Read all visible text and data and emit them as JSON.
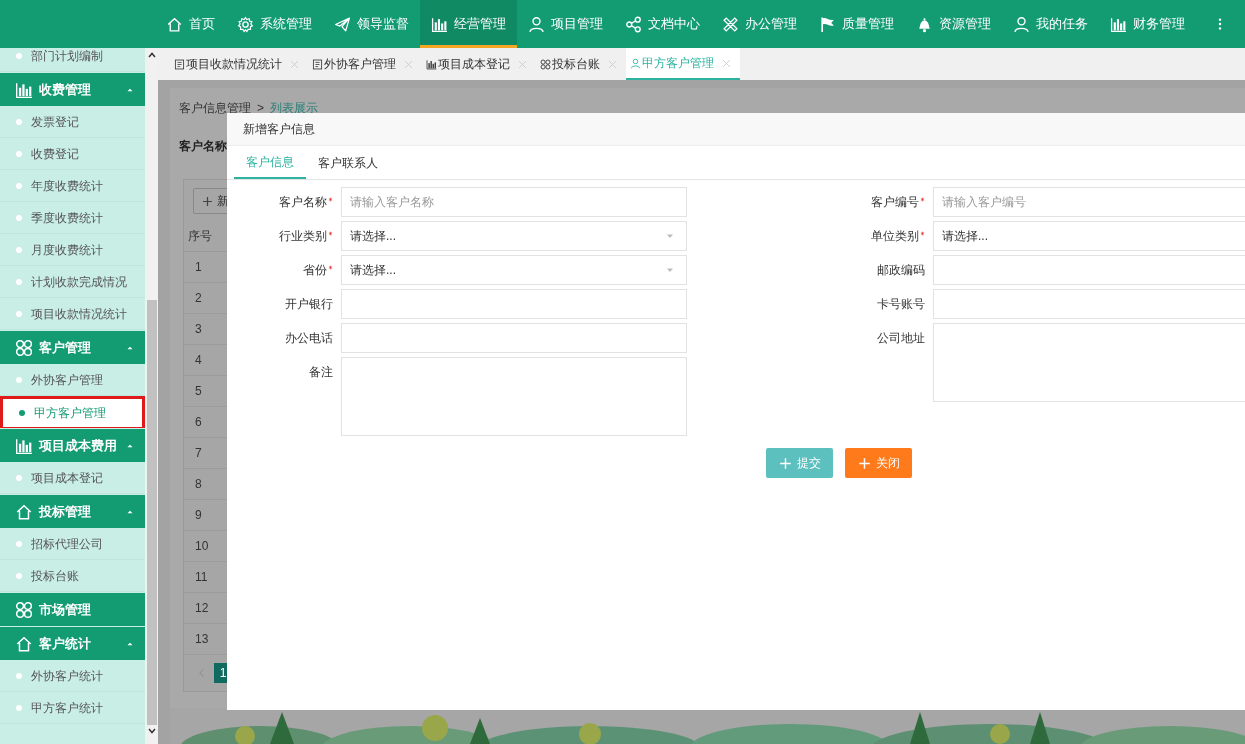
{
  "top_nav": {
    "items": [
      {
        "label": "首页",
        "selected": false
      },
      {
        "label": "系统管理",
        "selected": false
      },
      {
        "label": "领导监督",
        "selected": false
      },
      {
        "label": "经营管理",
        "selected": true
      },
      {
        "label": "项目管理",
        "selected": false
      },
      {
        "label": "文档中心",
        "selected": false
      },
      {
        "label": "办公管理",
        "selected": false
      },
      {
        "label": "质量管理",
        "selected": false
      },
      {
        "label": "资源管理",
        "selected": false
      },
      {
        "label": "我的任务",
        "selected": false
      },
      {
        "label": "财务管理",
        "selected": false
      }
    ]
  },
  "sidebar": {
    "items": [
      {
        "kind": "item",
        "label": "部门计划编制",
        "selected": false
      },
      {
        "kind": "group",
        "label": "收费管理",
        "expanded": true,
        "children": [
          {
            "label": "发票登记",
            "selected": false
          },
          {
            "label": "收费登记",
            "selected": false
          },
          {
            "label": "年度收费统计",
            "selected": false
          },
          {
            "label": "季度收费统计",
            "selected": false
          },
          {
            "label": "月度收费统计",
            "selected": false
          },
          {
            "label": "计划收款完成情况",
            "selected": false
          },
          {
            "label": "项目收款情况统计",
            "selected": false
          }
        ]
      },
      {
        "kind": "group",
        "label": "客户管理",
        "expanded": true,
        "children": [
          {
            "label": "外协客户管理",
            "selected": false
          },
          {
            "label": "甲方客户管理",
            "selected": true
          }
        ]
      },
      {
        "kind": "group",
        "label": "项目成本费用",
        "expanded": true,
        "children": [
          {
            "label": "项目成本登记",
            "selected": false
          }
        ]
      },
      {
        "kind": "group",
        "label": "投标管理",
        "expanded": true,
        "children": [
          {
            "label": "招标代理公司",
            "selected": false
          },
          {
            "label": "投标台账",
            "selected": false
          }
        ]
      },
      {
        "kind": "group",
        "label": "市场管理",
        "expanded": false
      },
      {
        "kind": "group",
        "label": "客户统计",
        "expanded": true,
        "children": [
          {
            "label": "外协客户统计",
            "selected": false
          },
          {
            "label": "甲方客户统计",
            "selected": false
          }
        ]
      }
    ]
  },
  "tabs": [
    {
      "label": "项目收款情况统计",
      "selected": false
    },
    {
      "label": "外协客户管理",
      "selected": false
    },
    {
      "label": "项目成本登记",
      "selected": false
    },
    {
      "label": "投标台账",
      "selected": false
    },
    {
      "label": "甲方客户管理",
      "selected": true
    }
  ],
  "background_page": {
    "breadcrumb": [
      "客户信息管理",
      "列表展示"
    ],
    "breadcrumb_separator": ">",
    "filter_label": "客户名称",
    "add_button": "新",
    "table": {
      "columns": [
        "序号"
      ],
      "rows": [
        "1",
        "2",
        "3",
        "4",
        "5",
        "6",
        "7",
        "8",
        "9",
        "10",
        "11",
        "12",
        "13"
      ]
    },
    "pagination": [
      {
        "label": "1",
        "selected": true
      }
    ]
  },
  "dialog": {
    "title": "新增客户信息",
    "tabs": [
      {
        "label": "客户信息",
        "selected": true
      },
      {
        "label": "客户联系人",
        "selected": false
      }
    ],
    "left_fields": [
      {
        "label": "客户名称",
        "required": true,
        "kind": "text",
        "placeholder": "请输入客户名称"
      },
      {
        "label": "行业类别",
        "required": true,
        "kind": "select",
        "value": "请选择..."
      },
      {
        "label": "省份",
        "required": true,
        "kind": "select",
        "value": "请选择..."
      },
      {
        "label": "开户银行",
        "required": false,
        "kind": "text"
      },
      {
        "label": "办公电话",
        "required": false,
        "kind": "text"
      },
      {
        "label": "备注",
        "required": false,
        "kind": "textarea"
      }
    ],
    "right_fields": [
      {
        "label": "客户编号",
        "required": true,
        "kind": "text",
        "placeholder": "请输入客户编号"
      },
      {
        "label": "单位类别",
        "required": true,
        "kind": "select",
        "value": "请选择..."
      },
      {
        "label": "邮政编码",
        "required": false,
        "kind": "text"
      },
      {
        "label": "卡号账号",
        "required": false,
        "kind": "text"
      },
      {
        "label": "公司地址",
        "required": false,
        "kind": "textarea"
      }
    ],
    "buttons": [
      {
        "label": "提交",
        "kind": "primary"
      },
      {
        "label": "关闭",
        "kind": "danger"
      }
    ]
  }
}
